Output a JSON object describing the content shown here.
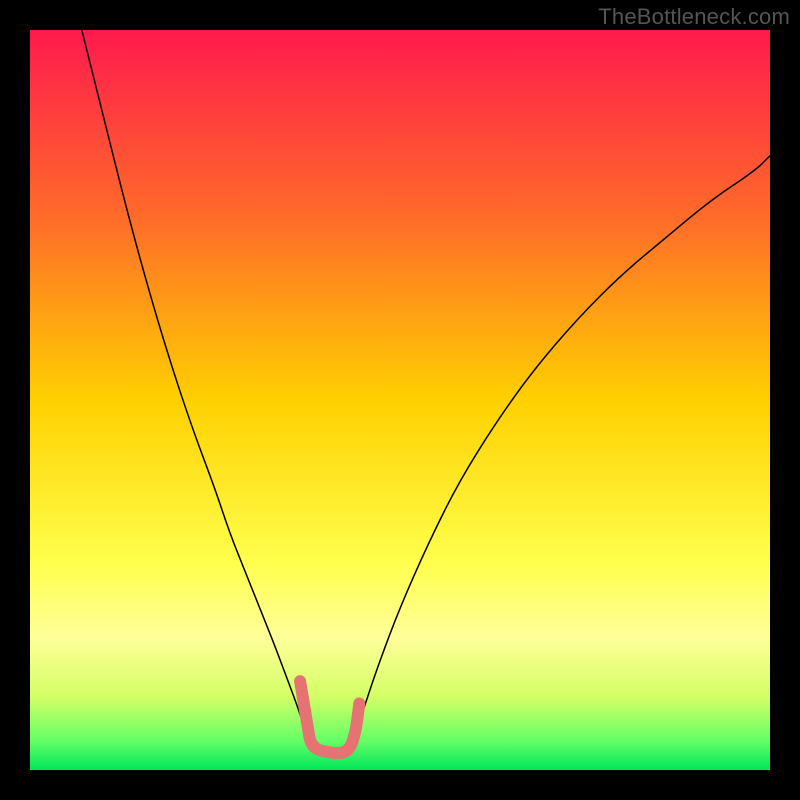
{
  "watermark": "TheBottleneck.com",
  "chart_data": {
    "type": "line",
    "title": "",
    "xlabel": "",
    "ylabel": "",
    "xlim": [
      0,
      100
    ],
    "ylim": [
      0,
      100
    ],
    "axes_visible": false,
    "gradient_stops": [
      {
        "offset": 0,
        "color": "#ff1a4d"
      },
      {
        "offset": 25,
        "color": "#ff6a2a"
      },
      {
        "offset": 50,
        "color": "#ffd000"
      },
      {
        "offset": 72,
        "color": "#ffff4d"
      },
      {
        "offset": 82,
        "color": "#ffff99"
      },
      {
        "offset": 90,
        "color": "#d4ff66"
      },
      {
        "offset": 96,
        "color": "#66ff66"
      },
      {
        "offset": 100,
        "color": "#00e65c"
      }
    ],
    "series": [
      {
        "name": "curve-left",
        "stroke": "#000000",
        "stroke_width": 1.5,
        "x": [
          7,
          10,
          13,
          16,
          19,
          22,
          25,
          27,
          29,
          31,
          33,
          34.5,
          36,
          37,
          37.8
        ],
        "y": [
          100,
          88,
          76,
          65,
          55,
          46,
          38,
          32,
          27,
          22,
          17,
          13,
          9,
          6,
          3.5
        ]
      },
      {
        "name": "curve-right",
        "stroke": "#000000",
        "stroke_width": 1.5,
        "x": [
          43.5,
          45,
          47,
          50,
          54,
          58,
          63,
          68,
          74,
          80,
          86,
          92,
          98,
          100
        ],
        "y": [
          3.5,
          8,
          14,
          22,
          31,
          39,
          47,
          54,
          61,
          67,
          72,
          77,
          81,
          83
        ]
      },
      {
        "name": "pink-segment",
        "stroke": "#e57373",
        "stroke_width": 12,
        "linecap": "round",
        "points": [
          {
            "x": 36.5,
            "y": 12
          },
          {
            "x": 37.5,
            "y": 6
          },
          {
            "x": 38.0,
            "y": 3.0
          },
          {
            "x": 40.5,
            "y": 2.3
          },
          {
            "x": 43.0,
            "y": 2.3
          },
          {
            "x": 44.0,
            "y": 5
          },
          {
            "x": 44.5,
            "y": 9
          }
        ]
      }
    ]
  }
}
